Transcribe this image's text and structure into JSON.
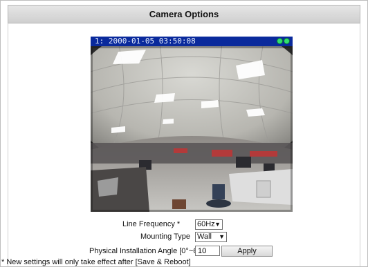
{
  "panel": {
    "title": "Camera Options"
  },
  "preview": {
    "osd_text": "1: 2000-01-05 03:50:08",
    "status_icons": [
      "record-indicator-icon",
      "record-indicator-icon"
    ],
    "status_color": "#30e070"
  },
  "form": {
    "line_frequency": {
      "label": "Line Frequency *",
      "value": "60Hz"
    },
    "mounting_type": {
      "label": "Mounting Type",
      "value": "Wall"
    },
    "installation_angle": {
      "label": "Physical Installation Angle  [0°~65°]",
      "value": "10",
      "apply_label": "Apply"
    }
  },
  "note": "* New settings will only take effect after [Save & Reboot]"
}
